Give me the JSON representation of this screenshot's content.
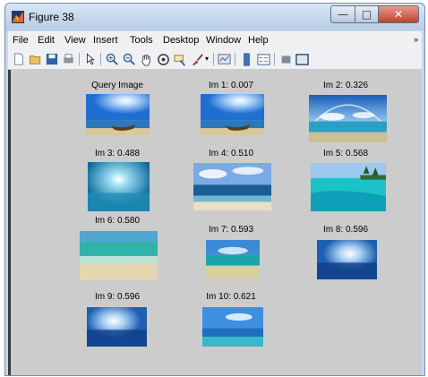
{
  "window": {
    "title": "Figure 38"
  },
  "menu": [
    "File",
    "Edit",
    "View",
    "Insert",
    "Tools",
    "Desktop",
    "Window",
    "Help"
  ],
  "toolbar": {
    "icons": [
      "new-figure-icon",
      "open-file-icon",
      "save-icon",
      "print-icon",
      "pointer-icon",
      "zoom-in-icon",
      "zoom-out-icon",
      "pan-icon",
      "rotate-3d-icon",
      "data-cursor-icon",
      "brush-icon",
      "link-icon",
      "colorbar-icon",
      "legend-icon",
      "hide-plot-tools-icon",
      "show-plot-tools-icon"
    ]
  },
  "figure": {
    "query_label": "Query Image",
    "results": [
      {
        "label": "Im 1: 0.007"
      },
      {
        "label": "Im 2: 0.326"
      },
      {
        "label": "Im 3: 0.488"
      },
      {
        "label": "Im 4: 0.510"
      },
      {
        "label": "Im 5: 0.568"
      },
      {
        "label": "Im 6: 0.580"
      },
      {
        "label": "Im 7: 0.593"
      },
      {
        "label": "Im 8: 0.596"
      },
      {
        "label": "Im 9: 0.596"
      },
      {
        "label": "Im 10: 0.621"
      }
    ]
  }
}
